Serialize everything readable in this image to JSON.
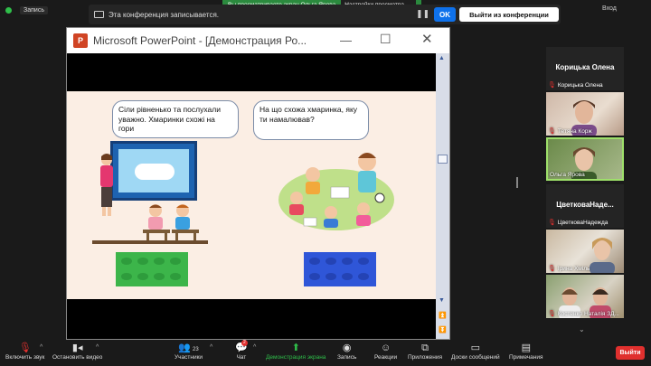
{
  "topbar": {
    "recording": "Запись",
    "viewing_text": "Вы просматриваете экран Ольга Ярова",
    "view_options": "Настройки просмотра",
    "rec_banner": "Эта конференция записывается.",
    "ok": "OK",
    "leave_conference": "Выйти из конференции",
    "signin": "Вход"
  },
  "ppt": {
    "title": "Microsoft PowerPoint - [Демонстрация Ро...",
    "bubble_left": "Сіли рівненько та послухали уважно. Хмаринки схожі на гори",
    "bubble_right": "На що схожа хмаринка, яку ти намалював?"
  },
  "participants": {
    "card1": "Корицька Олена",
    "tag1": "Корицька Олена",
    "vid1": "Тетяна Корж",
    "vid2": "Ольга Ярова",
    "card2": "ЦветковаНаде...",
    "tag2": "ЦветковаНадежда",
    "vid3": "Ірина Хміль",
    "vid4": "Костенко Наталія ЗД..."
  },
  "toolbar": {
    "unmute": "Включить звук",
    "start_video": "Остановить видео",
    "participants": "Участники",
    "participants_count": "23",
    "chat": "Чат",
    "chat_badge": "2",
    "share": "Демонстрация экрана",
    "record": "Запись",
    "reactions": "Реакции",
    "apps": "Приложения",
    "boards": "Доски сообщений",
    "notes": "Примечания",
    "leave": "Выйти"
  },
  "colors": {
    "accent": "#0e71eb",
    "green": "#2fbf4a",
    "danger": "#e0302e"
  }
}
